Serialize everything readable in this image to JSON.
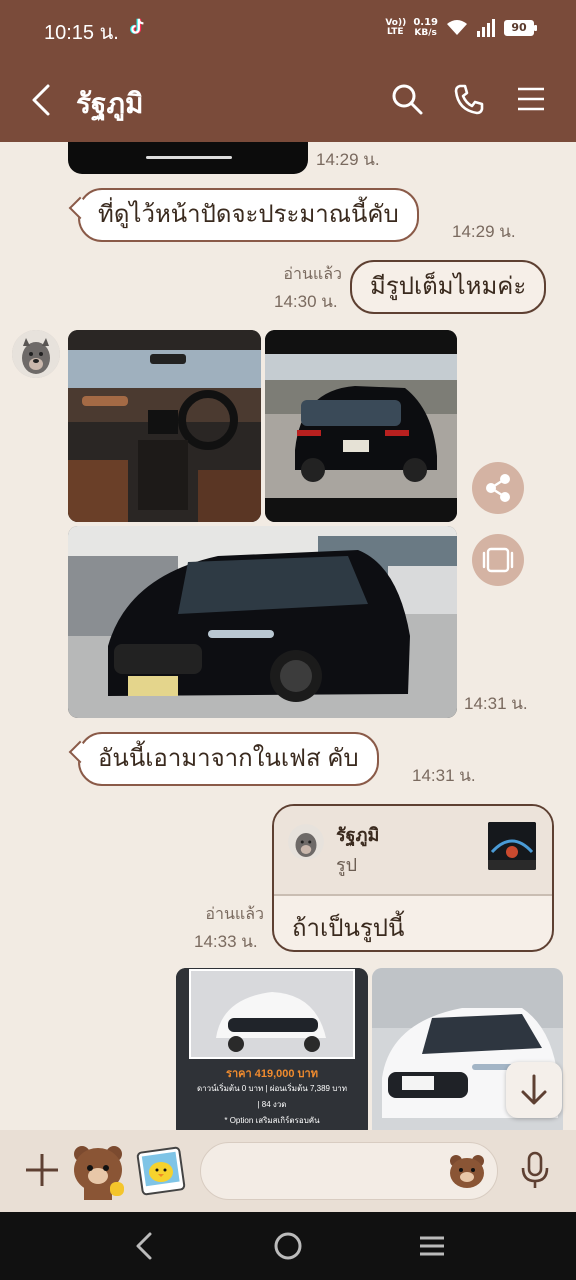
{
  "status": {
    "time": "10:15 น.",
    "network": "Vo)) LTE",
    "speed_value": "0.19",
    "speed_unit": "KB/s",
    "battery": "90"
  },
  "header": {
    "title": "รัฐภูมิ",
    "icons": [
      "back-arrow-icon",
      "search-icon",
      "phone-icon",
      "menu-icon"
    ]
  },
  "messages": [
    {
      "type": "image-partial",
      "time": "14:29 น."
    },
    {
      "type": "text",
      "side": "left",
      "text": "ที่ดูไว้หน้าปัดจะประมาณนี้คับ",
      "time": "14:29 น."
    },
    {
      "type": "text",
      "side": "right",
      "text": "มีรูปเต็มไหมค่ะ",
      "read": "อ่านแล้ว",
      "time": "14:30 น."
    },
    {
      "type": "photo-album",
      "side": "left",
      "count": 3,
      "time": "14:31 น."
    },
    {
      "type": "text",
      "side": "left",
      "text": "อันนี้เอามาจากในเฟส คับ",
      "time": "14:31 น."
    },
    {
      "type": "reply",
      "side": "right",
      "reply_name": "รัฐภูมิ",
      "reply_sub": "รูป",
      "text": "ถ้าเป็นรูปนี้",
      "read": "อ่านแล้ว",
      "time": "14:33 น."
    },
    {
      "type": "photo-album",
      "side": "right",
      "ad": {
        "price": "ราคา 419,000 บาท",
        "line1": "ดาวน์เริ่มต้น 0 บาท | ผ่อนเริ่มต้น 7,389 บาท",
        "line2": "| 84 งวด",
        "line3": "* Option เสริมสเกิร์ตรอบคัน"
      }
    }
  ],
  "input": {
    "placeholder": ""
  },
  "colors": {
    "header": "#7a4b3a",
    "background": "#f2ebe3",
    "bubble_border": "#8a5a48"
  }
}
